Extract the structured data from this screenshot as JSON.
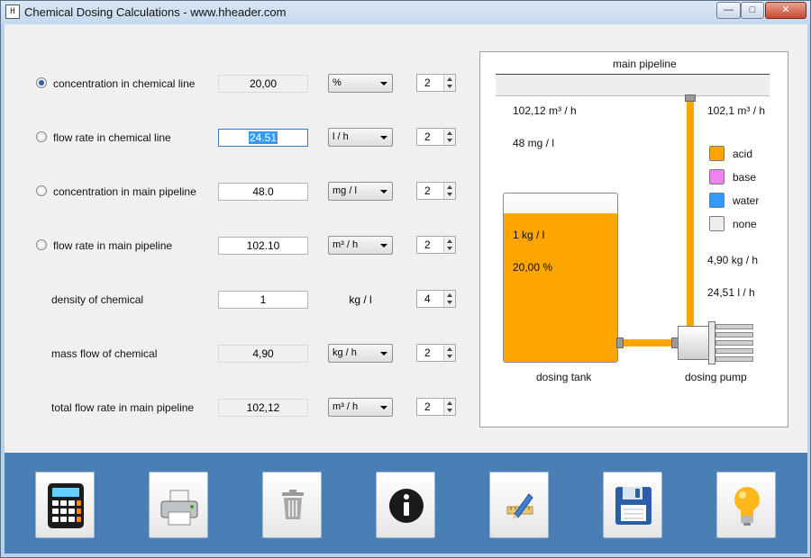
{
  "window": {
    "title": "Chemical Dosing Calculations - www.hheader.com",
    "app_icon": "H",
    "controls": {
      "minimize": "—",
      "maximize": "□",
      "close": "✕"
    }
  },
  "form": {
    "rows": [
      {
        "label": "concentration in chemical line",
        "radio": true,
        "radio_selected": true,
        "value": "20,00",
        "value_readonly": true,
        "unit": "%",
        "unit_dropdown": true,
        "decimals": "2"
      },
      {
        "label": "flow rate in chemical line",
        "radio": true,
        "radio_selected": false,
        "value": "24.51",
        "value_readonly": false,
        "value_selected": true,
        "unit": "l / h",
        "unit_dropdown": true,
        "decimals": "2"
      },
      {
        "label": "concentration in main pipeline",
        "radio": true,
        "radio_selected": false,
        "value": "48.0",
        "value_readonly": false,
        "unit": "mg / l",
        "unit_dropdown": true,
        "decimals": "2"
      },
      {
        "label": "flow rate in main pipeline",
        "radio": true,
        "radio_selected": false,
        "value": "102.10",
        "value_readonly": false,
        "unit": "m³ / h",
        "unit_dropdown": true,
        "decimals": "2"
      },
      {
        "label": "density of chemical",
        "radio": false,
        "value": "1",
        "value_readonly": false,
        "unit": "kg / l",
        "unit_dropdown": false,
        "decimals": "4"
      },
      {
        "label": "mass flow of chemical",
        "radio": false,
        "value": "4,90",
        "value_readonly": true,
        "unit": "kg / h",
        "unit_dropdown": true,
        "decimals": "2"
      },
      {
        "label": "total flow rate in main pipeline",
        "radio": false,
        "value": "102,12",
        "value_readonly": true,
        "unit": "m³ / h",
        "unit_dropdown": true,
        "decimals": "2"
      }
    ]
  },
  "diagram": {
    "title": "main pipeline",
    "main_flow_left": "102,12 m³ / h",
    "main_flow_right": "102,1 m³ / h",
    "concentration": "48 mg / l",
    "tank_density": "1 kg / l",
    "tank_concentration": "20,00 %",
    "tank_fill_fraction": 0.88,
    "tank_label": "dosing tank",
    "pump_label": "dosing pump",
    "mass_flow": "4,90 kg / h",
    "volume_flow": "24,51 l / h",
    "fluid_color": "#ffa500",
    "legend": [
      {
        "label": "acid",
        "color": "#ffa500"
      },
      {
        "label": "base",
        "color": "#ee82ee"
      },
      {
        "label": "water",
        "color": "#3399ff"
      },
      {
        "label": "none",
        "color": "#eeeeee"
      }
    ]
  },
  "toolbar": {
    "background": "#4a7fb5",
    "buttons": [
      {
        "icon": "calculator-icon"
      },
      {
        "icon": "printer-icon"
      },
      {
        "icon": "trash-icon"
      },
      {
        "icon": "info-icon"
      },
      {
        "icon": "edit-pencil-icon"
      },
      {
        "icon": "save-floppy-icon"
      },
      {
        "icon": "lightbulb-icon"
      }
    ]
  }
}
